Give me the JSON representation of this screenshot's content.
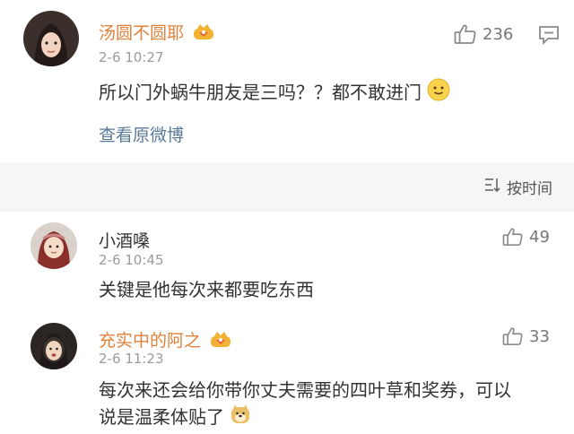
{
  "post": {
    "author": "汤圆不圆耶",
    "time": "2-6 10:27",
    "text": "所以门外蜗牛朋友是三吗？？都不敢进门",
    "view_original": "查看原微博",
    "likes": "236"
  },
  "sort": {
    "label": "按时间"
  },
  "comments": [
    {
      "author": "小酒嗓",
      "time": "2-6 10:45",
      "text": "关键是他每次来都要吃东西",
      "likes": "49"
    },
    {
      "author": "充实中的阿之",
      "time": "2-6 11:23",
      "text_line1": "每次来还会给你带你丈夫需要的四叶草和奖券，可以",
      "text_line2": "说是温柔体贴了",
      "likes": "33"
    }
  ],
  "colors": {
    "name_vip": "#e1813a",
    "link": "#5a7a9a",
    "band": "#f6f6f8"
  },
  "icons": [
    "thumbs-up-icon",
    "comment-icon",
    "crown-badge-icon",
    "smile-emoji-icon",
    "sort-icon",
    "doge-emoji-icon"
  ]
}
